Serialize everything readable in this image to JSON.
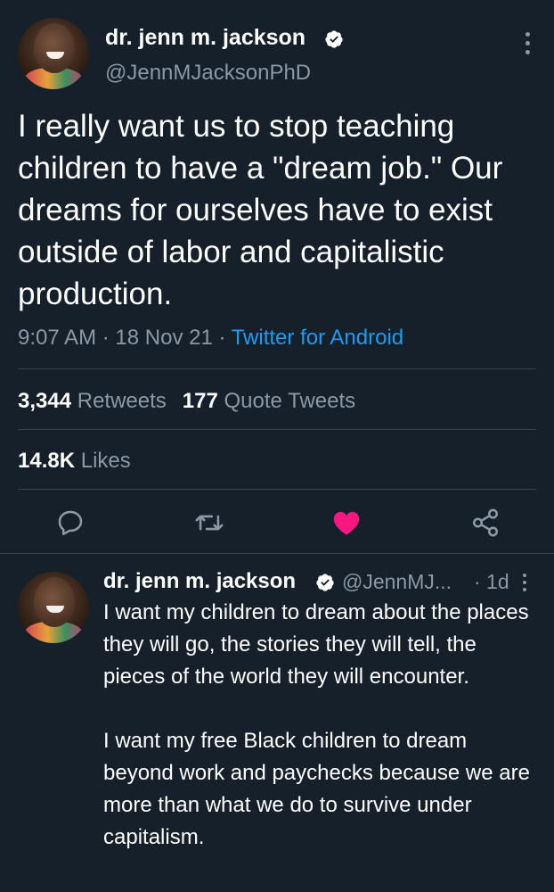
{
  "main_tweet": {
    "author_name": "dr. jenn m. jackson",
    "handle": "@JennMJacksonPhD",
    "text": "I really want us to stop teaching children to have a \"dream job.\" Our dreams for ourselves have to exist outside of labor and capitalistic production.",
    "time": "9:07 AM",
    "date": "18 Nov 21",
    "source": "Twitter for Android",
    "separator": "·",
    "retweets_count": "3,344",
    "retweets_label": "Retweets",
    "quote_count": "177",
    "quote_label": "Quote Tweets",
    "likes_count": "14.8K",
    "likes_label": "Likes"
  },
  "reply_tweet": {
    "author_name": "dr. jenn m. jackson",
    "handle": "@JennMJ...",
    "time_ago": "· 1d",
    "paragraph_1": "I want my children to dream about the places they will go, the stories they will tell, the pieces of the world they will encounter.",
    "paragraph_2": "I want my free Black children to dream beyond work and paychecks because we are more than what we do to survive under capitalism."
  },
  "icons": {
    "verified": "verified-badge-icon",
    "more": "more-options-icon",
    "reply": "reply-icon",
    "retweet": "retweet-icon",
    "like": "heart-icon",
    "share": "share-icon"
  },
  "colors": {
    "background": "#15202b",
    "text": "#ffffff",
    "secondary": "#8b98a5",
    "link": "#1d9bf0",
    "like_active": "#f91880",
    "divider": "#38444d"
  }
}
